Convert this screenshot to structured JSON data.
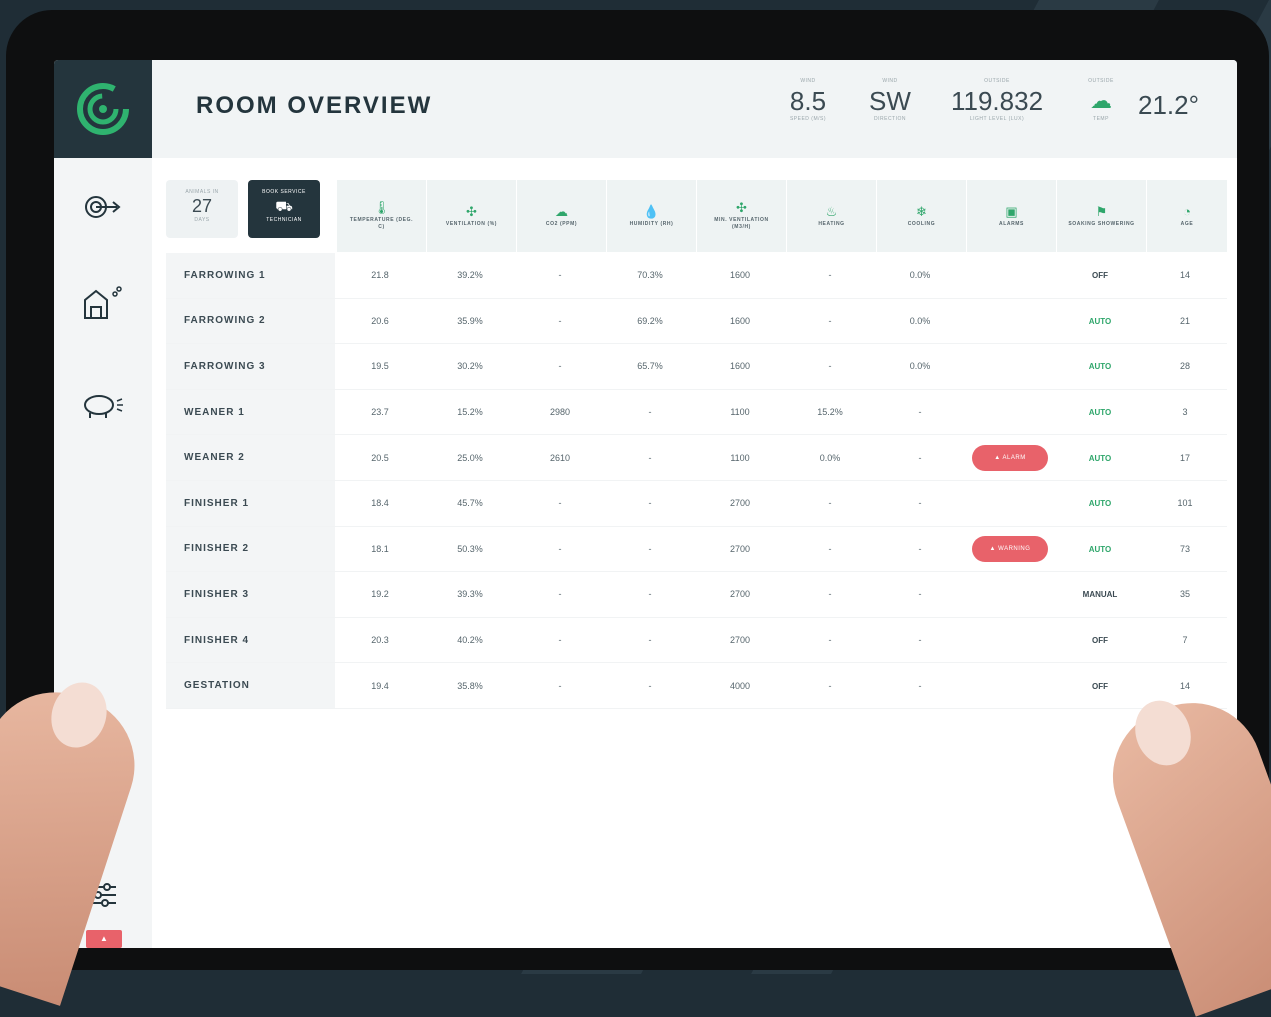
{
  "header": {
    "title": "ROOM OVERVIEW",
    "metrics": [
      {
        "caption": "WIND",
        "value": "8.5",
        "sub": "SPEED (M/S)"
      },
      {
        "caption": "WIND",
        "value": "SW",
        "sub": "DIRECTION"
      },
      {
        "caption": "OUTSIDE",
        "value": "119.832",
        "sub": "LIGHT LEVEL (LUX)"
      },
      {
        "caption": "OUTSIDE",
        "value": "21.2°",
        "sub": "TEMP",
        "icon": "cloud-sun-icon"
      }
    ]
  },
  "cards": {
    "stock": {
      "caption": "ANIMALS IN",
      "value": "27",
      "sub": "DAYS"
    },
    "service": {
      "caption": "BOOK SERVICE",
      "sub": "TECHNICIAN",
      "icon": "truck-icon"
    }
  },
  "sidebar": {
    "items": [
      {
        "icon": "target-icon"
      },
      {
        "icon": "barn-icon"
      },
      {
        "icon": "pig-icon"
      }
    ],
    "settings_icon": "sliders-icon"
  },
  "table": {
    "columns": [
      {
        "label": "TEMPERATURE (DEG. C)",
        "icon": "thermometer-icon"
      },
      {
        "label": "VENTILATION (%)",
        "icon": "fan-icon"
      },
      {
        "label": "CO2 (PPM)",
        "icon": "cloud-icon"
      },
      {
        "label": "HUMIDITY (RH)",
        "icon": "droplet-icon"
      },
      {
        "label": "MIN. VENTILATION (M3/H)",
        "icon": "fan-icon"
      },
      {
        "label": "HEATING",
        "icon": "heat-icon"
      },
      {
        "label": "COOLING",
        "icon": "cooling-icon"
      },
      {
        "label": "ALARMS",
        "icon": "alarm-icon"
      },
      {
        "label": "SOAKING SHOWERING",
        "icon": "shower-icon"
      },
      {
        "label": "AGE",
        "icon": "pig-icon"
      }
    ],
    "rows": [
      {
        "room": "FARROWING 1",
        "cells": [
          "21.8",
          "39.2%",
          "-",
          "70.3%",
          "1600",
          "-",
          "0.0%",
          "",
          "OFF",
          "14"
        ],
        "status": "off"
      },
      {
        "room": "FARROWING 2",
        "cells": [
          "20.6",
          "35.9%",
          "-",
          "69.2%",
          "1600",
          "-",
          "0.0%",
          "",
          "AUTO",
          "21"
        ],
        "status": "auto"
      },
      {
        "room": "FARROWING 3",
        "cells": [
          "19.5",
          "30.2%",
          "-",
          "65.7%",
          "1600",
          "-",
          "0.0%",
          "",
          "AUTO",
          "28"
        ],
        "status": "auto"
      },
      {
        "room": "WEANER 1",
        "cells": [
          "23.7",
          "15.2%",
          "2980",
          "-",
          "1100",
          "15.2%",
          "-",
          "",
          "AUTO",
          "3"
        ],
        "status": "auto"
      },
      {
        "room": "WEANER 2",
        "cells": [
          "20.5",
          "25.0%",
          "2610",
          "-",
          "1100",
          "0.0%",
          "-",
          "ALARM",
          "AUTO",
          "17"
        ],
        "status": "auto"
      },
      {
        "room": "FINISHER 1",
        "cells": [
          "18.4",
          "45.7%",
          "-",
          "-",
          "2700",
          "-",
          "-",
          "",
          "AUTO",
          "101"
        ],
        "status": "auto"
      },
      {
        "room": "FINISHER 2",
        "cells": [
          "18.1",
          "50.3%",
          "-",
          "-",
          "2700",
          "-",
          "-",
          "WARNING",
          "AUTO",
          "73"
        ],
        "status": "auto"
      },
      {
        "room": "FINISHER 3",
        "cells": [
          "19.2",
          "39.3%",
          "-",
          "-",
          "2700",
          "-",
          "-",
          "",
          "MANUAL",
          "35"
        ],
        "status": "manual"
      },
      {
        "room": "FINISHER 4",
        "cells": [
          "20.3",
          "40.2%",
          "-",
          "-",
          "2700",
          "-",
          "-",
          "",
          "OFF",
          "7"
        ],
        "status": "off"
      },
      {
        "room": "GESTATION",
        "cells": [
          "19.4",
          "35.8%",
          "-",
          "-",
          "4000",
          "-",
          "-",
          "",
          "OFF",
          "14"
        ],
        "status": "off"
      }
    ]
  },
  "colors": {
    "accent": "#2fa66b",
    "dark": "#24353d",
    "alarm": "#e8626a"
  }
}
